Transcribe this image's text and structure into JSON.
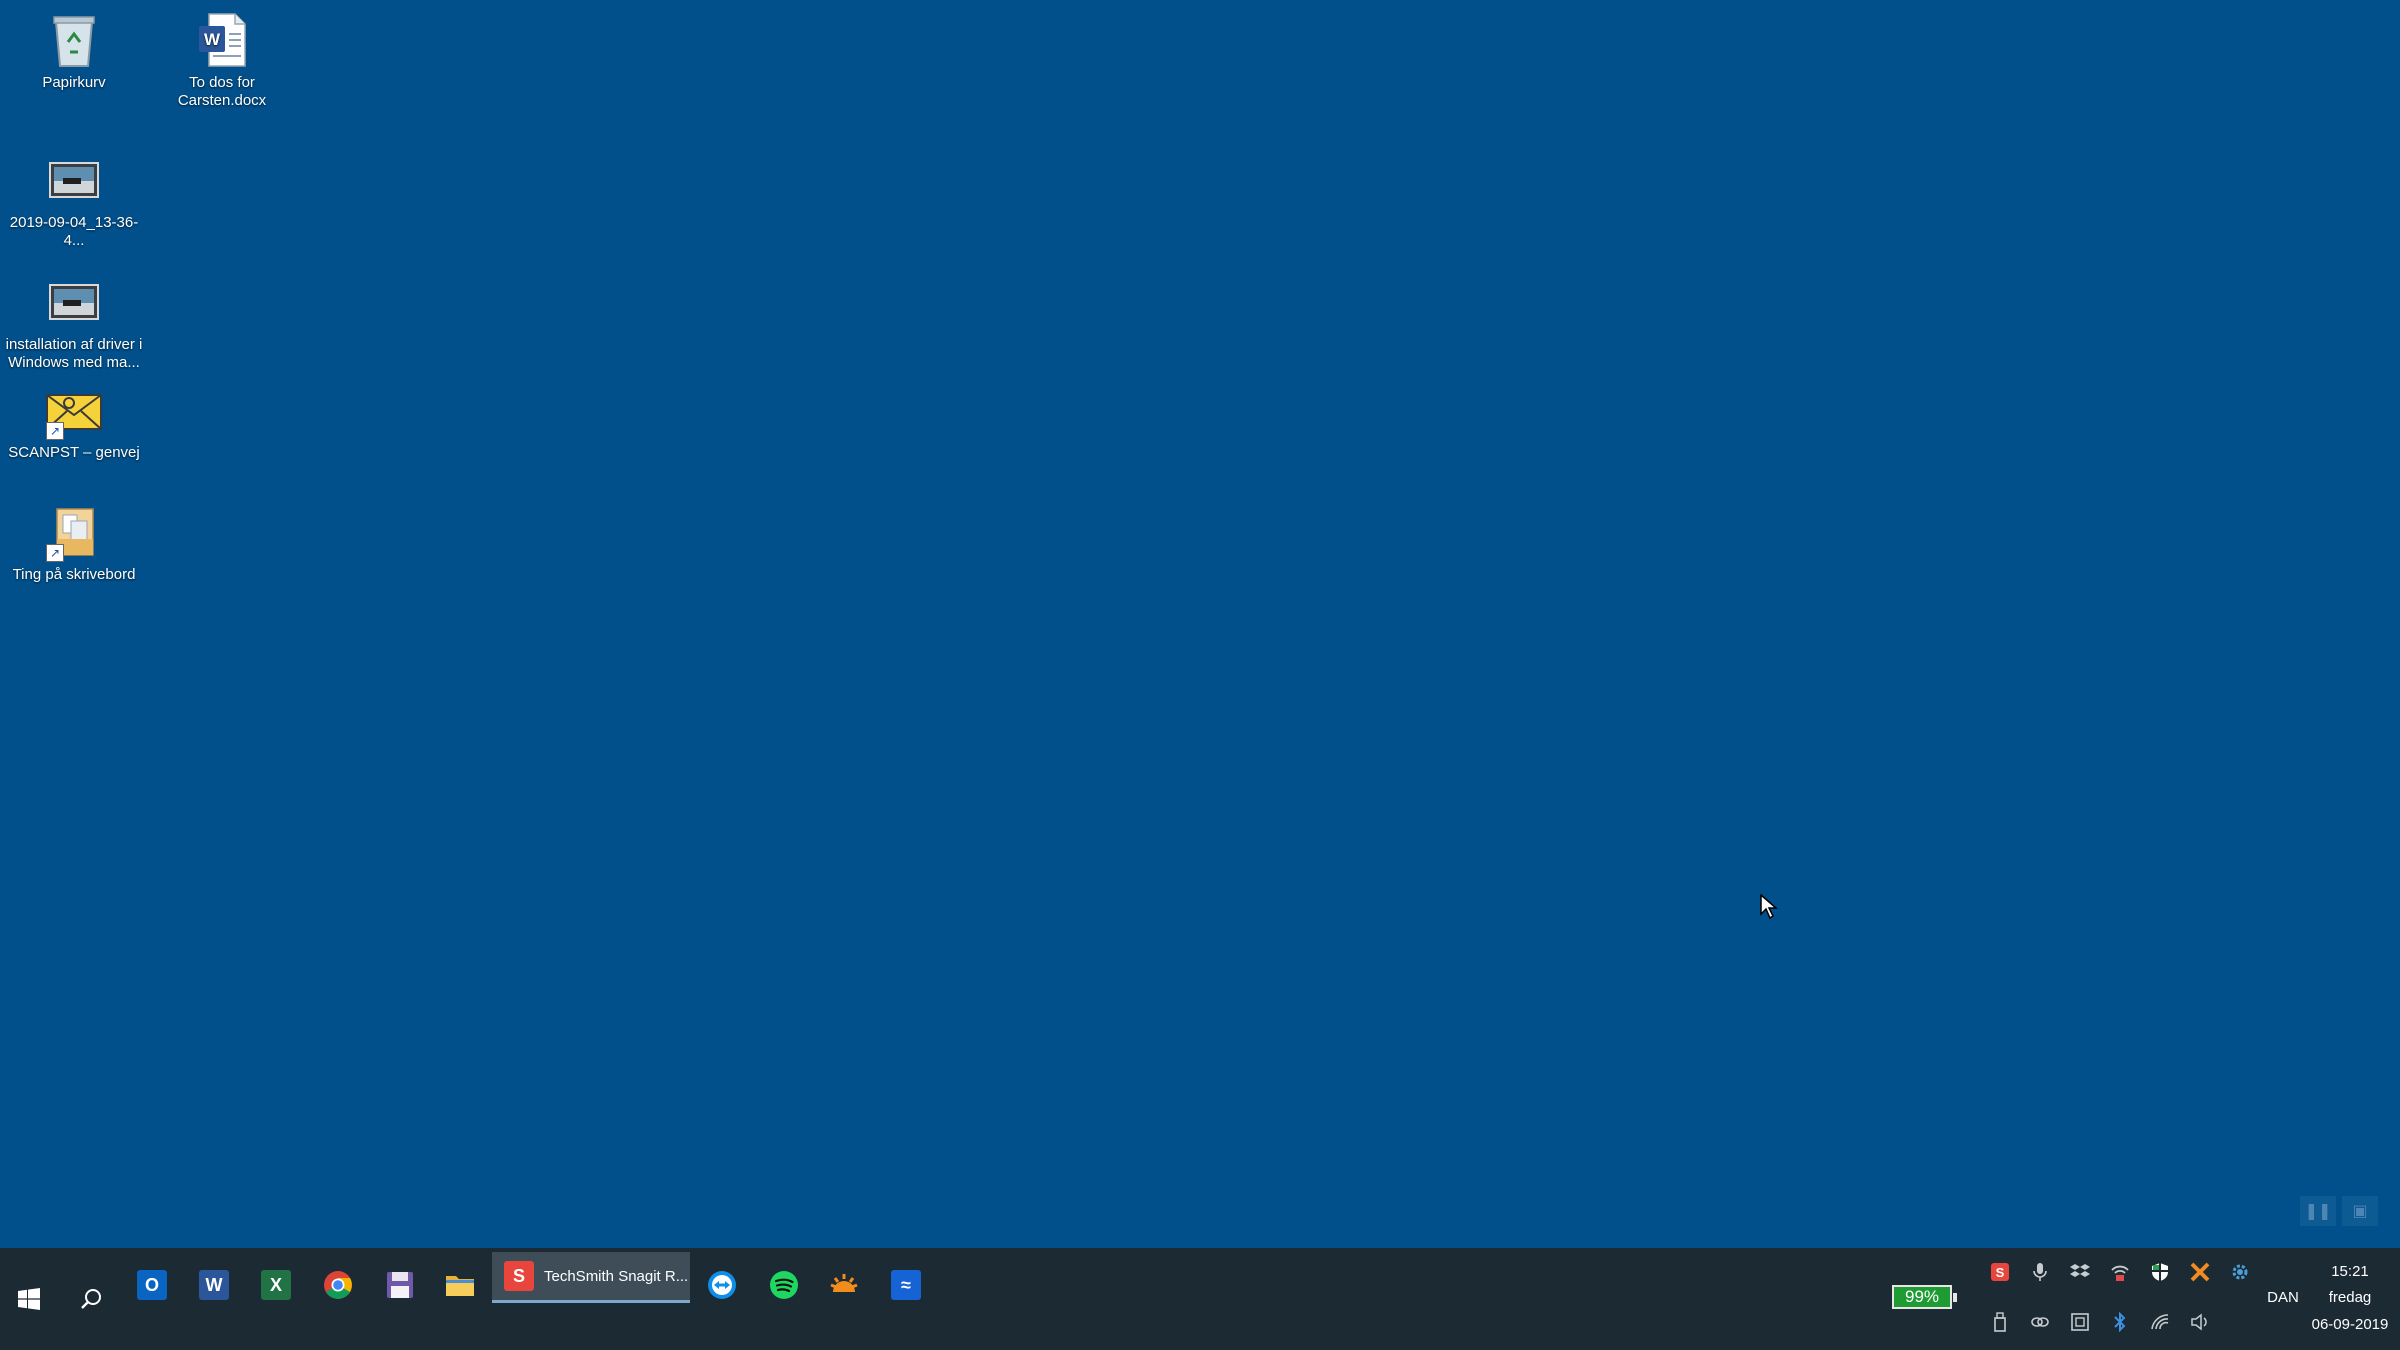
{
  "desktop": {
    "icons": [
      {
        "label": "Papirkurv"
      },
      {
        "label": "To dos for Carsten.docx"
      },
      {
        "label": "2019-09-04_13-36-4..."
      },
      {
        "label": "installation af driver i Windows med ma..."
      },
      {
        "label": "SCANPST – genvej"
      },
      {
        "label": "Ting på skrivebord"
      }
    ]
  },
  "taskbar": {
    "pinned": [
      {
        "name": "Outlook",
        "glyph": "O",
        "color": "#0a64c2"
      },
      {
        "name": "Word",
        "glyph": "W",
        "color": "#2b579a"
      },
      {
        "name": "Excel",
        "glyph": "X",
        "color": "#217346"
      },
      {
        "name": "Chrome",
        "glyph": "",
        "color": "#db4437"
      },
      {
        "name": "Save",
        "glyph": "",
        "color": "#6e5aa8"
      },
      {
        "name": "File Explorer",
        "glyph": "",
        "color": "#f0c040"
      }
    ],
    "active_task": {
      "label": "TechSmith Snagit R...",
      "glyph": "S"
    },
    "tray": {
      "battery": "99%",
      "language": "DAN",
      "time": "15:21",
      "day": "fredag",
      "date": "06-09-2019"
    }
  },
  "colors": {
    "desktop": "#01508c",
    "taskbar": "#1c2a33",
    "accent": "#7ea8cc"
  }
}
